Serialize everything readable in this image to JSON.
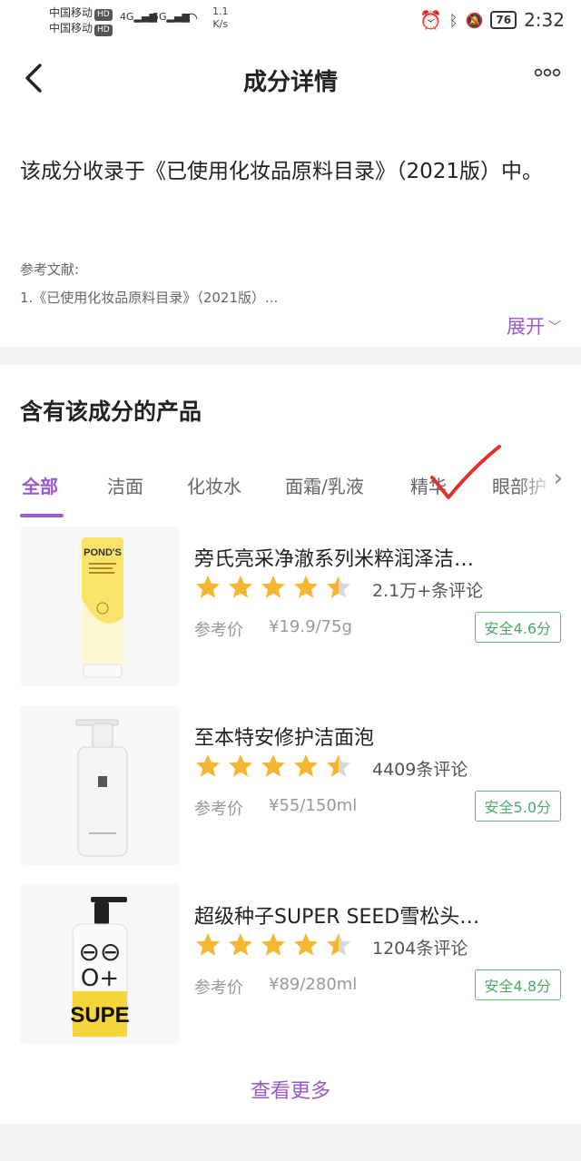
{
  "status_bar": {
    "carrier1": "中国移动",
    "carrier2": "中国移动",
    "hd": "HD",
    "net1": "4G",
    "net2": "5G",
    "speed_value": "1.1",
    "speed_unit": "K/s",
    "battery": "76",
    "time": "2:32"
  },
  "header": {
    "title": "成分详情",
    "back_icon": "chevron-left-icon",
    "more_icon": "more-dots-icon"
  },
  "ingredient": {
    "description": "该成分收录于《已使用化妆品原料目录》（2021版）中。",
    "references_label": "参考文献:",
    "reference_1": "1.《已使用化妆品原料目录》（2021版）...",
    "expand_label": "展开"
  },
  "products_section": {
    "title": "含有该成分的产品",
    "tabs": [
      "全部",
      "洁面",
      "化妆水",
      "面霜/乳液",
      "精华",
      "眼部护"
    ],
    "active_tab": 0,
    "view_more": "查看更多",
    "accent": "#9b59c9",
    "safe_color": "#4aaa6a",
    "star_color": "#f5b731"
  },
  "products": [
    {
      "name": "旁氏亮采净澈系列米粹润泽洁…",
      "rating": 4.5,
      "reviews": "2.1万+条评论",
      "price_label": "参考价",
      "price": "¥19.9/75g",
      "safety": "安全4.6分",
      "brand_text": "POND'S"
    },
    {
      "name": "至本特安修护洁面泡",
      "rating": 4.5,
      "reviews": "4409条评论",
      "price_label": "参考价",
      "price": "¥55/150ml",
      "safety": "安全5.0分"
    },
    {
      "name": "超级种子SUPER SEED雪松头…",
      "rating": 4.5,
      "reviews": "1204条评论",
      "price_label": "参考价",
      "price": "¥89/280ml",
      "safety": "安全4.8分",
      "brand_text": "SUPE"
    }
  ]
}
